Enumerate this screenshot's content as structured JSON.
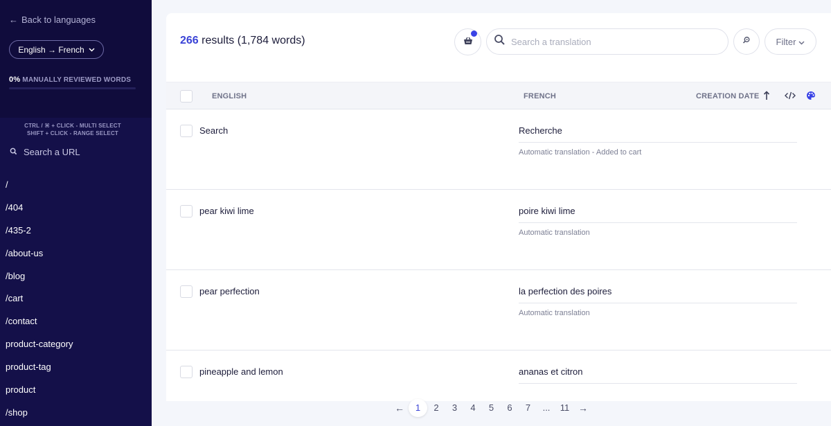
{
  "sidebar": {
    "back_label": "Back to languages",
    "language_pair": "English → French",
    "review_percent": "0%",
    "review_label": "MANUALLY REVIEWED WORDS",
    "review_progress": 0,
    "shortcut_multi": "CTRL / ⌘ + CLICK - MULTI SELECT",
    "shortcut_range": "SHIFT + CLICK - RANGE SELECT",
    "url_search_placeholder": "Search a URL",
    "urls": [
      "/",
      "/404",
      "/435-2",
      "/about-us",
      "/blog",
      "/cart",
      "/contact",
      "product-category",
      "product-tag",
      "product",
      "/shop"
    ]
  },
  "header": {
    "result_count": "266",
    "result_suffix": " results (1,784 words)",
    "search_placeholder": "Search a translation",
    "filter_label": "Filter"
  },
  "table": {
    "columns": {
      "source": "ENGLISH",
      "target": "FRENCH",
      "date": "CREATION DATE"
    },
    "rows": [
      {
        "source": "Search",
        "target": "Recherche",
        "note": "Automatic translation - Added to cart"
      },
      {
        "source": "pear kiwi lime",
        "target": "poire kiwi lime",
        "note": "Automatic translation"
      },
      {
        "source": "pear perfection",
        "target": "la perfection des poires",
        "note": "Automatic translation"
      },
      {
        "source": "pineapple and lemon",
        "target": "ananas et citron",
        "note": ""
      }
    ]
  },
  "pagination": {
    "prev": "←",
    "next": "→",
    "pages": [
      "1",
      "2",
      "3",
      "4",
      "5",
      "6",
      "7",
      "...",
      "11"
    ],
    "current": "1"
  },
  "colors": {
    "sidebar": "#141049",
    "accent": "#3a43d6"
  }
}
